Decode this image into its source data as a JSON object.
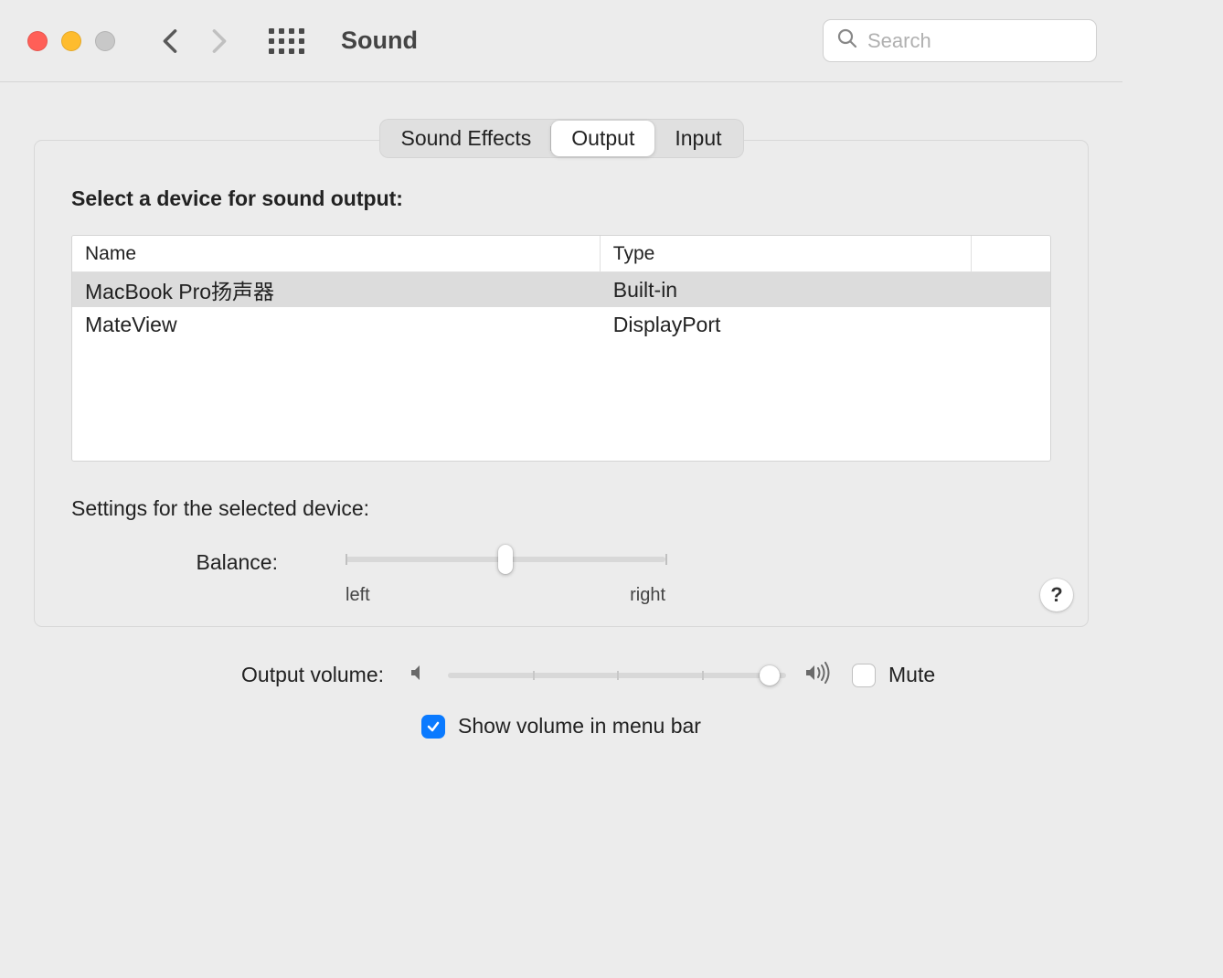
{
  "window": {
    "title": "Sound"
  },
  "search": {
    "placeholder": "Search"
  },
  "tabs": {
    "sound_effects": "Sound Effects",
    "output": "Output",
    "input": "Input",
    "active": "output"
  },
  "output_section": {
    "heading": "Select a device for sound output:",
    "columns": {
      "name": "Name",
      "type": "Type"
    },
    "rows": [
      {
        "name": "MacBook Pro扬声器",
        "type": "Built-in",
        "selected": true
      },
      {
        "name": "MateView",
        "type": "DisplayPort",
        "selected": false
      }
    ]
  },
  "settings_section": {
    "heading": "Settings for the selected device:",
    "balance": {
      "label": "Balance:",
      "left_label": "left",
      "right_label": "right",
      "value_percent": 50
    }
  },
  "help": {
    "label": "?"
  },
  "footer": {
    "output_volume_label": "Output volume:",
    "output_volume_percent": 95,
    "mute": {
      "label": "Mute",
      "checked": false
    },
    "show_volume_menubar": {
      "label": "Show volume in menu bar",
      "checked": true
    }
  }
}
